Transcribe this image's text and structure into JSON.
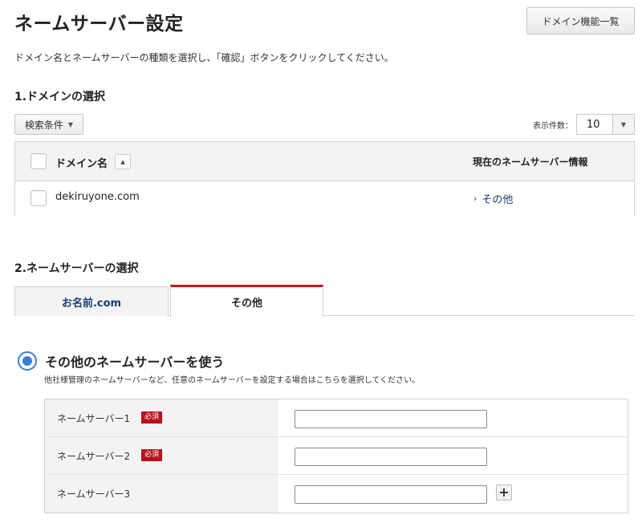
{
  "header": {
    "title": "ネームサーバー設定",
    "domain_list_button": "ドメイン機能一覧"
  },
  "intro": "ドメイン名とネームサーバーの種類を選択し、「確認」ボタンをクリックしてください。",
  "section1": {
    "title": "1.ドメインの選択",
    "filter_button": "検索条件",
    "count_label": "表示件数：",
    "count_value": "10",
    "table": {
      "col_domain": "ドメイン名",
      "col_ns": "現在のネームサーバー情報",
      "rows": [
        {
          "domain": "dekiruyone.com",
          "ns_info": "その他",
          "checked": false
        }
      ]
    }
  },
  "section2": {
    "title": "2.ネームサーバーの選択",
    "tabs": [
      {
        "label": "お名前.com",
        "active": false
      },
      {
        "label": "その他",
        "active": true
      }
    ],
    "radio_label": "その他のネームサーバーを使う",
    "radio_selected": true,
    "radio_desc": "他社様管理のネームサーバーなど、任意のネームサーバーを設定する場合はこちらを選択してください。",
    "nameservers": [
      {
        "label": "ネームサーバー1",
        "required": "必須",
        "value": ""
      },
      {
        "label": "ネームサーバー2",
        "required": "必須",
        "value": ""
      },
      {
        "label": "ネームサーバー3",
        "required": "",
        "value": ""
      }
    ]
  },
  "colors": {
    "accent_red": "#c41a1a",
    "required_badge": "#b8111b",
    "radio_blue": "#3c7fd6",
    "link_navy": "#1a3c6e"
  },
  "icons": {
    "filter_caret": "caret-down-icon",
    "select_arrow": "chevron-down-icon",
    "sort": "sort-ascending-icon",
    "ns_link": "chevron-right-icon",
    "add_nameserver": "plus-icon"
  }
}
